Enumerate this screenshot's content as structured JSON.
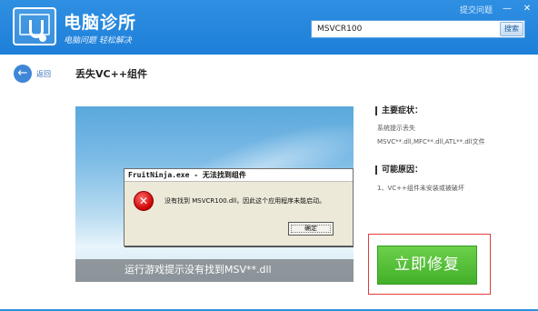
{
  "header": {
    "app_title": "电脑诊所",
    "slogan": "电脑问题 轻松解决",
    "help_link": "提交问题",
    "search": {
      "value": "MSVCR100",
      "button": "搜索"
    },
    "window_controls": {
      "minimize": "—",
      "close": "✕"
    }
  },
  "nav": {
    "back_label": "返回",
    "back_icon": "←"
  },
  "page": {
    "title": "丢失VC++组件"
  },
  "screenshot": {
    "dialog_title": "FruitNinja.exe - 无法找到组件",
    "error_icon": "✕",
    "message": "没有找到 MSVCR100.dll，因此这个应用程序未能启动。",
    "ok_button": "确定",
    "caption": "运行游戏提示没有找到MSV**.dll"
  },
  "info": {
    "symptoms_title": "主要症状：",
    "symptoms_line1": "系统提示丢失",
    "symptoms_line2": "MSVC**.dll,MFC**.dll,ATL**.dll文件",
    "causes_title": "可能原因：",
    "causes_line1": "1、VC++组件未安装或被破坏"
  },
  "action": {
    "fix_button": "立即修复"
  },
  "colors": {
    "header_blue": "#1d7fd8",
    "fix_green": "#43b02a",
    "highlight_red": "#e23b3b"
  }
}
